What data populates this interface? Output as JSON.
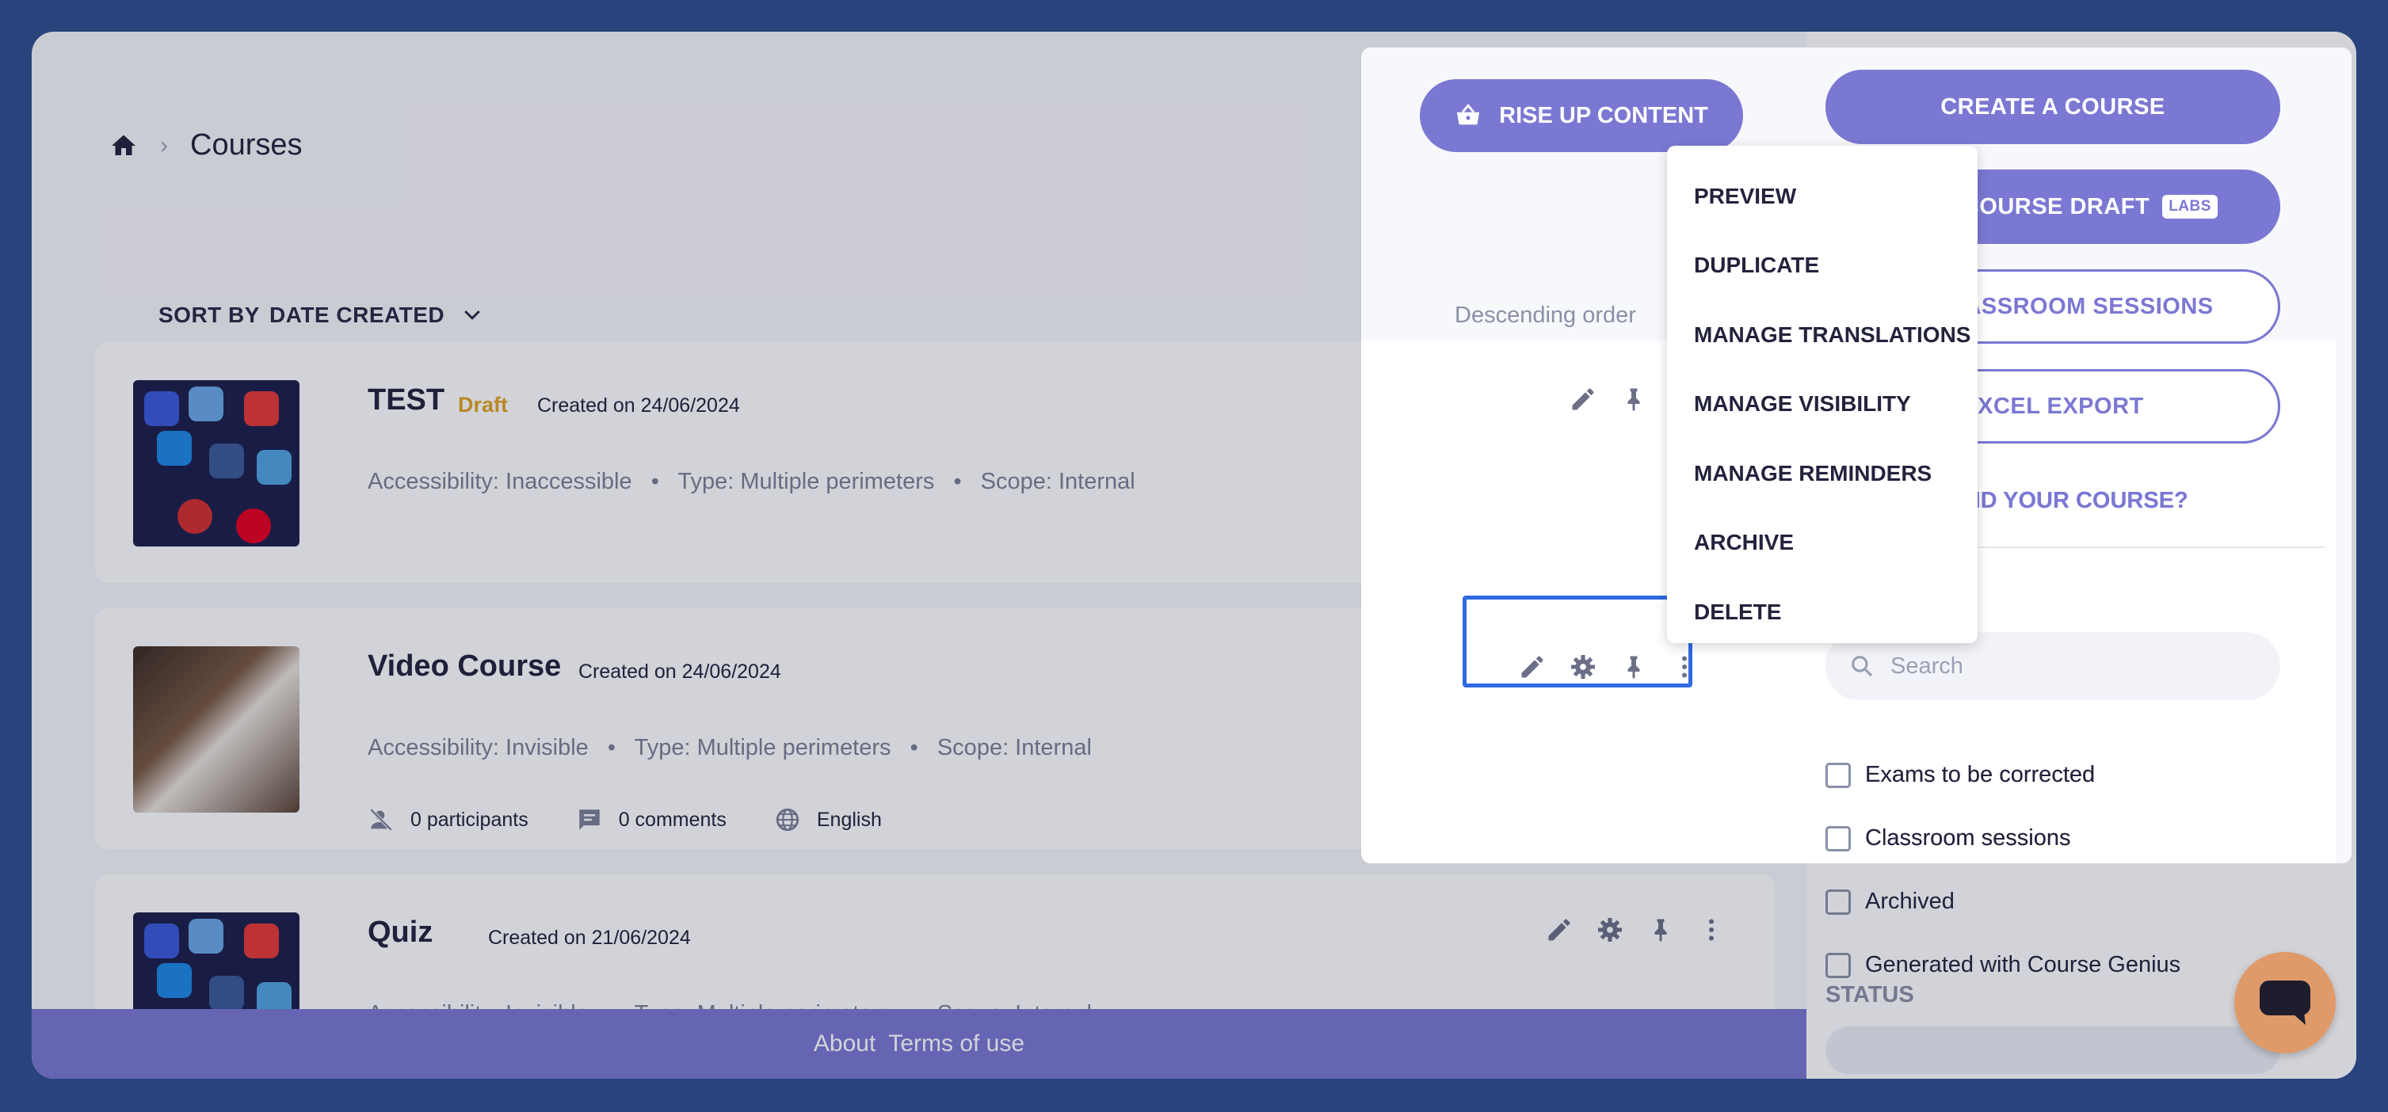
{
  "breadcrumb": {
    "title": "Courses"
  },
  "sort": {
    "prefix": "SORT BY",
    "value": "DATE CREATED"
  },
  "order": "Descending order",
  "courses": [
    {
      "title": "TEST",
      "badge": "Draft",
      "created": "Created on 24/06/2024",
      "accessibility": "Accessibility: Inaccessible",
      "type": "Type: Multiple perimeters",
      "scope": "Scope: Internal"
    },
    {
      "title": "Video Course",
      "created": "Created on 24/06/2024",
      "accessibility": "Accessibility: Invisible",
      "type": "Type: Multiple perimeters",
      "scope": "Scope: Internal",
      "participants": "0 participants",
      "comments": "0 comments",
      "language": "English"
    },
    {
      "title": "Quiz",
      "created": "Created on 21/06/2024",
      "accessibility": "Accessibility: Invisible",
      "type": "Type: Multiple perimeters",
      "scope": "Scope: Internal"
    }
  ],
  "meta_separator": "•",
  "footer": {
    "about": "About",
    "terms": "Terms of use"
  },
  "sidebar": {
    "rise_up": "RISE UP CONTENT",
    "create_course": "CREATE A COURSE",
    "create_draft": "ATE A COURSE DRAFT",
    "labs": "LABS",
    "classroom": "GE CLASSROOM SESSIONS",
    "excel": "EXCEL EXPORT",
    "cant_find": "'T FIND YOUR COURSE?",
    "search_placeholder": "Search",
    "filters": [
      "Exams to be corrected",
      "Classroom sessions",
      "Archived",
      "Generated with Course Genius"
    ],
    "status_label": "STATUS"
  },
  "menu": [
    "PREVIEW",
    "DUPLICATE",
    "MANAGE TRANSLATIONS",
    "MANAGE VISIBILITY",
    "MANAGE REMINDERS",
    "ARCHIVE",
    "DELETE"
  ],
  "colors": {
    "accent": "#7b78d3",
    "draft": "#e0a323",
    "selection": "#2e6be0",
    "chat": "#e09a69"
  }
}
